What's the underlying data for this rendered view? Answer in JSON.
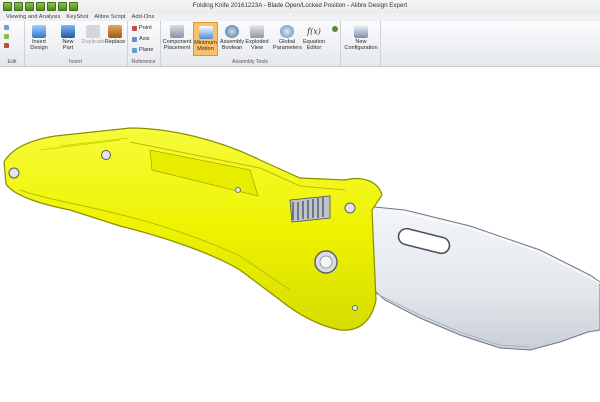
{
  "window": {
    "title": "Folding Knife 20161223A - Blade Open/Locked Position - Alibre Design Expert"
  },
  "menu": [
    "Viewing and Analysis",
    "KeyShot",
    "Alibre Script",
    "Add-Ons"
  ],
  "ribbon": {
    "groups": {
      "edit": "Edit",
      "insert": "Insert",
      "reference": "Reference",
      "assembly_tools": "Assembly Tools"
    },
    "buttons": {
      "insert_design": "Insert\nDesign",
      "new_part": "New\nPart",
      "duplicate": "Duplicate",
      "replace": "Replace",
      "point": "Point",
      "axis": "Axis",
      "plane": "Plane",
      "component_placement": "Component\nPlacement",
      "minimum_motion": "Minimum\nMotion",
      "assembly_boolean": "Assembly\nBoolean",
      "exploded_view": "Exploded\nView",
      "global_parameters": "Global\nParameters",
      "equation_editor": "Equation\nEditor",
      "new_configuration": "New\nConfiguration"
    }
  },
  "colors": {
    "handle": "#f0f500",
    "blade": "#e4e8ed",
    "active_button": "#f9c26a"
  }
}
